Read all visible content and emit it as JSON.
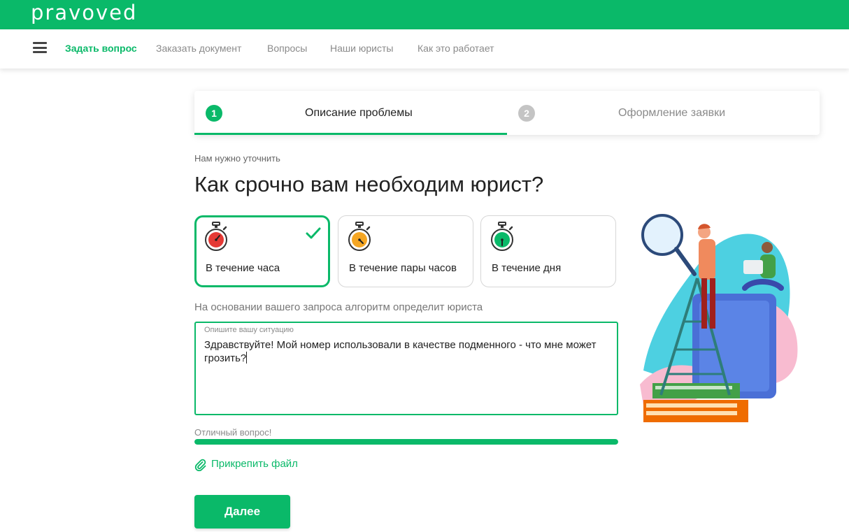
{
  "header": {
    "logo": "pravoved"
  },
  "nav": {
    "items": [
      {
        "label": "Задать вопрос",
        "active": true
      },
      {
        "label": "Заказать документ",
        "active": false
      },
      {
        "label": "Вопросы",
        "active": false
      },
      {
        "label": "Наши юристы",
        "active": false
      },
      {
        "label": "Как это работает",
        "active": false
      }
    ]
  },
  "stepper": {
    "steps": [
      {
        "number": "1",
        "label": "Описание проблемы",
        "active": true
      },
      {
        "number": "2",
        "label": "Оформление заявки",
        "active": false
      }
    ]
  },
  "form": {
    "subtitle": "Нам нужно уточнить",
    "title": "Как срочно вам необходим юрист?",
    "urgency_options": [
      {
        "label": "В течение часа",
        "selected": true,
        "timer_color": "#e53935"
      },
      {
        "label": "В течение пары часов",
        "selected": false,
        "timer_color": "#f5a623"
      },
      {
        "label": "В течение дня",
        "selected": false,
        "timer_color": "#0ab969"
      }
    ],
    "hint": "На основании вашего запроса алгоритм определит юриста",
    "situation_placeholder": "Опишите вашу ситуацию",
    "situation_value": "Здравствуйте! Мой номер использовали в качестве подменного - что мне может грозить?",
    "quality_text": "Отличный вопрос!",
    "quality_progress": 1.0,
    "attach_label": "Прикрепить файл",
    "next_button": "Далее"
  },
  "colors": {
    "brand": "#0ab969",
    "text": "#222222",
    "muted": "#8a8a8a"
  }
}
